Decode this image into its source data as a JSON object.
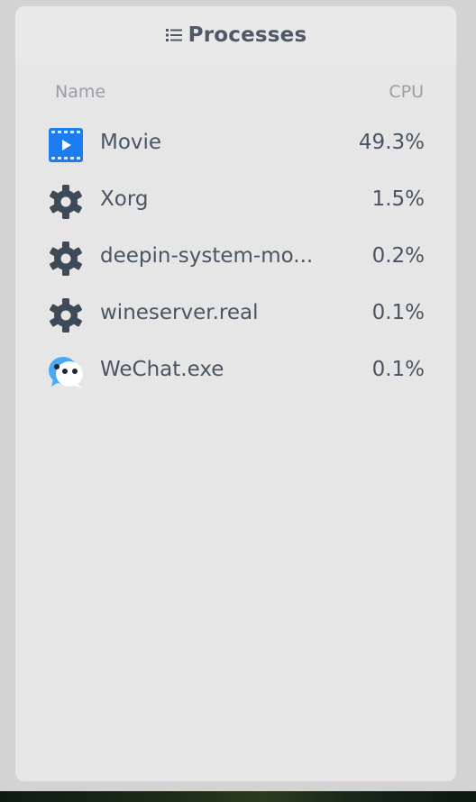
{
  "panel": {
    "title": "Processes",
    "header_icon": "list-icon"
  },
  "columns": {
    "name": "Name",
    "cpu": "CPU"
  },
  "processes": [
    {
      "name": "Movie",
      "cpu": "49.3%",
      "icon": "movie-icon"
    },
    {
      "name": "Xorg",
      "cpu": "1.5%",
      "icon": "gear-icon"
    },
    {
      "name": "deepin-system-mo...",
      "cpu": "0.2%",
      "icon": "gear-icon"
    },
    {
      "name": "wineserver.real",
      "cpu": "0.1%",
      "icon": "gear-icon"
    },
    {
      "name": "WeChat.exe",
      "cpu": "0.1%",
      "icon": "wechat-icon"
    }
  ],
  "colors": {
    "movie_icon": "#1e7cf2",
    "gear_icon": "#3e4a56",
    "wechat_icon": "#48a9f5"
  }
}
